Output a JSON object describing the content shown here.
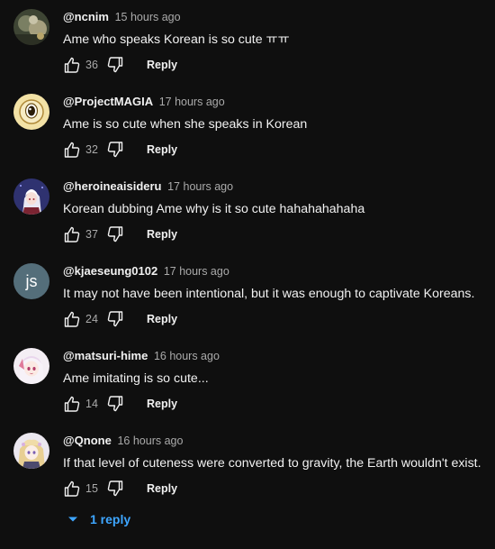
{
  "comments": [
    {
      "author": "@ncnim",
      "time": "15 hours ago",
      "text": "Ame who speaks Korean is so cute ㅠㅠ",
      "likes": "36",
      "reply_label": "Reply",
      "avatar": {
        "type": "photo",
        "bg": "#4f5742",
        "accent": "#c9c2a6"
      }
    },
    {
      "author": "@ProjectMAGIA",
      "time": "17 hours ago",
      "text": "Ame is so cute when she speaks in Korean",
      "likes": "32",
      "reply_label": "Reply",
      "avatar": {
        "type": "eye",
        "bg": "#f5e6b3",
        "accent": "#9a7a2f"
      }
    },
    {
      "author": "@heroineaisideru",
      "time": "17 hours ago",
      "text": "Korean dubbing Ame why is it so cute hahahahahaha",
      "likes": "37",
      "reply_label": "Reply",
      "avatar": {
        "type": "anime",
        "bg": "#3b3d7a",
        "accent": "#e6e6f2"
      }
    },
    {
      "author": "@kjaeseung0102",
      "time": "17 hours ago",
      "text": "It may not have been intentional, but it was enough to captivate Koreans.",
      "likes": "24",
      "reply_label": "Reply",
      "avatar": {
        "type": "letters",
        "bg": "#546e7a",
        "letters": "js"
      }
    },
    {
      "author": "@matsuri-hime",
      "time": "16 hours ago",
      "text": "Ame imitating is so cute...",
      "likes": "14",
      "reply_label": "Reply",
      "avatar": {
        "type": "anime-pink",
        "bg": "#f3eef3",
        "accent": "#e07a9a"
      }
    },
    {
      "author": "@Qnone",
      "time": "16 hours ago",
      "text": "If that level of cuteness were converted to gravity, the Earth wouldn't exist.",
      "likes": "15",
      "reply_label": "Reply",
      "avatar": {
        "type": "anime-blonde",
        "bg": "#e9e6ee",
        "accent": "#e3c98a"
      }
    }
  ],
  "replies_toggle": {
    "label": "1 reply",
    "icon": "chevron-down-icon"
  },
  "colors": {
    "background": "#0f0f0f",
    "text": "#f1f1f1",
    "muted": "#aaaaaa",
    "link": "#3ea6ff"
  }
}
